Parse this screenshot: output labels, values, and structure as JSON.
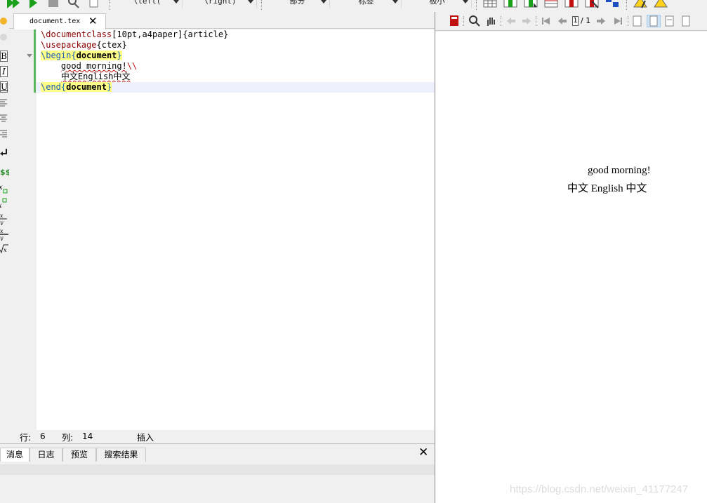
{
  "toolbar": {
    "combos": [
      "\\left(",
      "\\right)",
      "部分",
      "标签",
      "极小"
    ]
  },
  "editor": {
    "tab_label": "document.tex",
    "lines": {
      "l1_cmd": "\\documentclass",
      "l1_rest": "[10pt,a4paper]{article}",
      "l2_cmd": "\\usepackage",
      "l2_rest": "{ctex}",
      "l3_cmd": "\\begin",
      "l3_env": "document",
      "l4_text": "good morning!",
      "l4_break": "\\\\",
      "l5_text": "中文English中文",
      "l6_cmd": "\\end",
      "l6_env": "document"
    }
  },
  "status": {
    "row_label": "行:",
    "row_value": "6",
    "col_label": "列:",
    "col_value": "14",
    "mode": "插入"
  },
  "bottom_tabs": [
    "消息",
    "日志",
    "预览",
    "搜索结果"
  ],
  "pdf_toolbar": {
    "page_current": "1",
    "page_total": "/ 1"
  },
  "pdf": {
    "line1": "good morning!",
    "line2": "中文 English 中文"
  },
  "watermark": "https://blog.csdn.net/weixin_41177247",
  "left_toolbar": {
    "bold": "B",
    "italic": "I",
    "underline": "U",
    "dollars": "$$"
  },
  "colors": {
    "accent_green": "#5ab85a",
    "highlight_yellow": "#ffff88",
    "current_line": "#eef0fb"
  }
}
